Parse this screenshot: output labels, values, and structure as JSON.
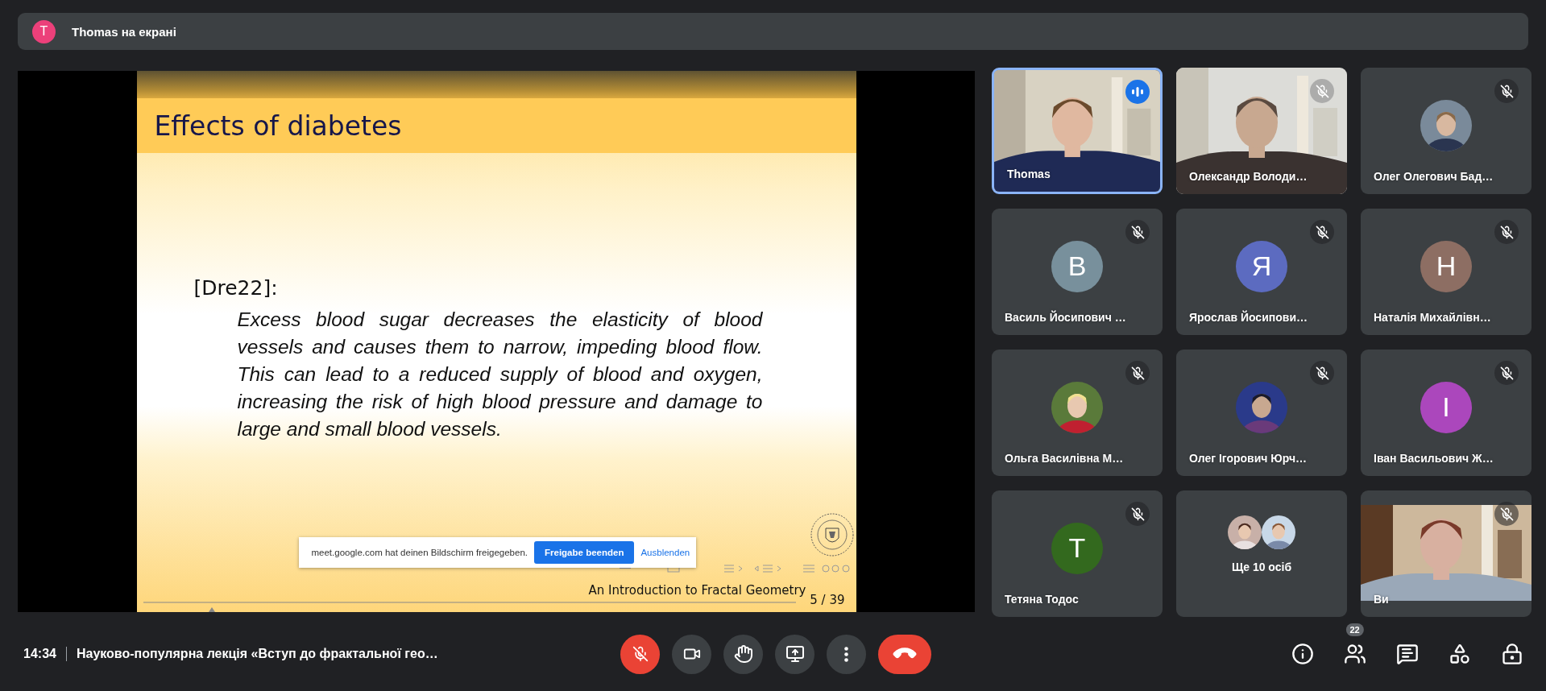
{
  "presenter_bar": {
    "initial": "T",
    "color": "#ec407a",
    "text": "Thomas на екрані"
  },
  "slide": {
    "title": "Effects of diabetes",
    "citation": "[Dre22]:",
    "quote": "Excess blood sugar decreases the elasticity of blood vessels and causes them to narrow, impeding blood flow.  This can lead to a reduced supply of blood and oxygen, increasing the risk of high blood pressure and damage to large and small blood vessels.",
    "footer_title": "An Introduction to Fractal Geometry",
    "page": "5 / 39"
  },
  "share_notice": {
    "text": "meet.google.com hat deinen Bildschirm freigegeben.",
    "stop_button": "Freigabe beenden",
    "hide_link": "Ausblenden"
  },
  "participants": [
    {
      "kind": "video",
      "name": "Thomas",
      "muted": false,
      "speaking": true
    },
    {
      "kind": "video",
      "name": "Олександр Володи…",
      "muted": true,
      "speaking": false
    },
    {
      "name": "Олег Олегович Бад…",
      "muted": true,
      "speaking": false
    },
    {
      "kind": "letter",
      "initial": "В",
      "color": "#78909c",
      "name": "Василь Йосипович …",
      "muted": true,
      "speaking": false
    },
    {
      "kind": "letter",
      "initial": "Я",
      "color": "#5c6bc0",
      "name": "Ярослав Йосипови…",
      "muted": true,
      "speaking": false
    },
    {
      "kind": "letter",
      "initial": "Н",
      "color": "#8d6e63",
      "name": "Наталія Михайлівн…",
      "muted": true,
      "speaking": false
    },
    {
      "name": "Ольга Василівна М…",
      "muted": true,
      "speaking": false
    },
    {
      "name": "Олег Ігорович Юрч…",
      "muted": true,
      "speaking": false
    },
    {
      "kind": "letter",
      "initial": "І",
      "color": "#ab47bc",
      "name": "Іван Васильович Ж…",
      "muted": true,
      "speaking": false
    },
    {
      "kind": "letter",
      "initial": "Т",
      "color": "#33691e",
      "name": "Тетяна Тодос",
      "muted": true,
      "speaking": false
    },
    {
      "kind": "more",
      "name": "Ще 10 осіб"
    },
    {
      "kind": "self_video",
      "name": "Ви",
      "muted": true,
      "speaking": false
    }
  ],
  "meeting": {
    "time": "14:34",
    "title": "Науково-популярна лекція «Вступ до фрактальної гео…"
  },
  "controls": [
    {
      "kind": "mic",
      "on": false
    },
    {
      "kind": "camera",
      "on": true
    },
    {
      "kind": "hand",
      "on": false
    },
    {
      "kind": "present",
      "on": false
    },
    {
      "kind": "more"
    },
    {
      "kind": "leave"
    }
  ],
  "side_controls": [
    {
      "kind": "info"
    },
    {
      "kind": "people",
      "badge": "22"
    },
    {
      "kind": "chat"
    },
    {
      "kind": "activities"
    },
    {
      "kind": "host"
    }
  ]
}
